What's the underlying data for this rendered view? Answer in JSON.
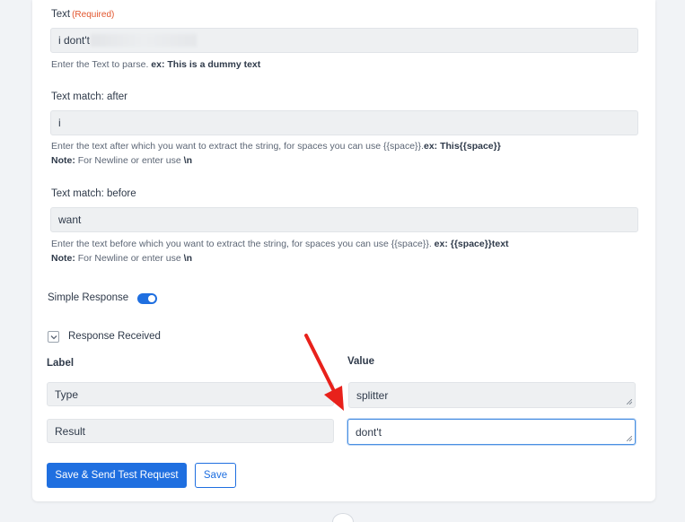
{
  "text_field": {
    "label": "Text",
    "required": "(Required)",
    "value": "i dont't",
    "help_prefix": "Enter the Text to parse.",
    "help_example": "ex: This is a dummy text"
  },
  "match_after": {
    "label": "Text match: after",
    "value": "i",
    "help_prefix": "Enter the text after which you want to extract the string, for spaces you can use {{space}}.",
    "help_example": "ex: This{{space}}",
    "note_label": "Note:",
    "note_text": "For Newline or enter use",
    "note_code": "\\n"
  },
  "match_before": {
    "label": "Text match: before",
    "value": "want",
    "help_prefix": "Enter the text before which you want to extract the string, for spaces you can use {{space}}.",
    "help_example": "ex: {{space}}text",
    "note_label": "Note:",
    "note_text": "For Newline or enter use",
    "note_code": "\\n"
  },
  "simple_response": {
    "label": "Simple Response",
    "on": true
  },
  "response_received": {
    "label": "Response Received"
  },
  "table": {
    "label_header": "Label",
    "value_header": "Value",
    "rows": [
      {
        "label": "Type",
        "value": "splitter"
      },
      {
        "label": "Result",
        "value": "dont't"
      }
    ]
  },
  "buttons": {
    "save_send": "Save & Send Test Request",
    "save": "Save"
  },
  "colors": {
    "accent": "#1f6fe0",
    "required": "#e2552d",
    "arrow": "#e8211b"
  },
  "icons": [
    "chevron-down-icon",
    "resize-handle-icon",
    "red-arrow-annotation"
  ]
}
